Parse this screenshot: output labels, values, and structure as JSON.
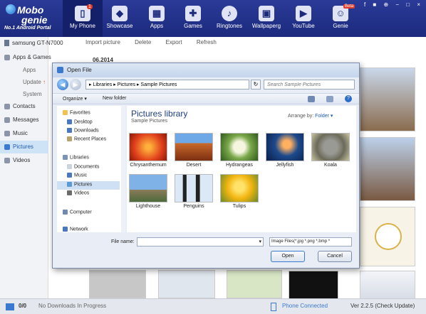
{
  "app": {
    "logo_line1": "Mobo",
    "logo_line2": "genie",
    "logo_sub": "No.1 Android Portal",
    "window_controls": "f ■ ⊕ − □ ×"
  },
  "nav": {
    "items": [
      {
        "label": "My Phone",
        "icon": "phone-icon",
        "badge": "1"
      },
      {
        "label": "Showcase",
        "icon": "cube-icon"
      },
      {
        "label": "Apps",
        "icon": "apps-icon"
      },
      {
        "label": "Games",
        "icon": "gamepad-icon"
      },
      {
        "label": "Ringtones",
        "icon": "music-icon"
      },
      {
        "label": "Wallpaperg",
        "icon": "wallpaper-icon"
      },
      {
        "label": "YouTube",
        "icon": "youtube-icon"
      },
      {
        "label": "Genie",
        "icon": "genie-icon",
        "badge": "Beta"
      }
    ]
  },
  "sidebar": {
    "device": "samsung GT-N7000",
    "apps_games": "Apps & Games",
    "sub_apps": "Apps",
    "sub_update": "Update",
    "sub_system": "System",
    "contacts": "Contacts",
    "messages": "Messages",
    "music": "Music",
    "pictures": "Pictures",
    "videos": "Videos"
  },
  "toolbar": {
    "import": "Import picture",
    "delete": "Delete",
    "export": "Export",
    "refresh": "Refresh",
    "date_group": "06.2014"
  },
  "dialog": {
    "title": "Open File",
    "address": "▸ Libraries ▸ Pictures ▸ Sample Pictures",
    "search_placeholder": "Search Sample Pictures",
    "organize": "Organize ▾",
    "new_folder": "New folder",
    "help": "?",
    "nav": {
      "favorites": "Favorites",
      "desktop": "Desktop",
      "downloads": "Downloads",
      "recent": "Recent Places",
      "libraries": "Libraries",
      "documents": "Documents",
      "music": "Music",
      "pictures": "Pictures",
      "videos": "Videos",
      "computer": "Computer",
      "network": "Network"
    },
    "library_title": "Pictures library",
    "library_sub": "Sample Pictures",
    "arrange_label": "Arrange by:",
    "arrange_value": "Folder ▾",
    "files": [
      "Chrysanthemum",
      "Desert",
      "Hydrangeas",
      "Jellyfish",
      "Koala",
      "Lighthouse",
      "Penguins",
      "Tulips"
    ],
    "file_name_label": "File name:",
    "file_name_value": "",
    "file_type": "Image Files(*.jpg *.png *.bmp *",
    "open": "Open",
    "cancel": "Cancel"
  },
  "status": {
    "download_count": "0/0",
    "download_text": "No Downloads In Progress",
    "connection": "Phone Connected",
    "version": "Ver  2.2.5  (Check Update)"
  },
  "colors": {
    "topbar": "#1c2a7e",
    "accent": "#3a79cf",
    "library_title": "#1e3f83"
  }
}
